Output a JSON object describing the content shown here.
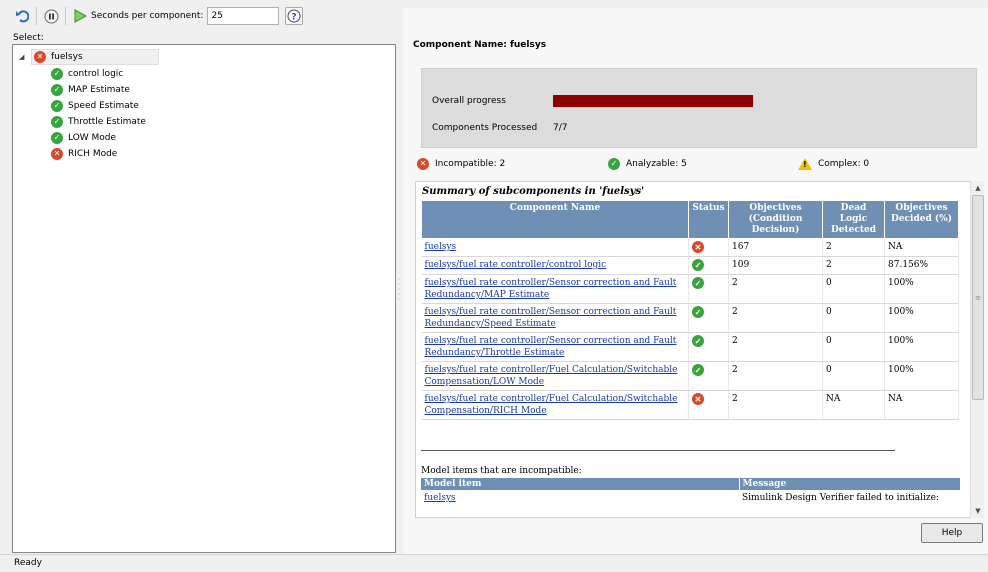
{
  "toolbar": {
    "undo_icon": "undo-icon",
    "pause_icon": "pause-icon",
    "play_icon": "play-icon",
    "seconds_label": "Seconds per component:",
    "seconds_value": "25",
    "help_icon": "help-icon"
  },
  "left": {
    "select_label": "Select:",
    "tree": {
      "root": {
        "label": "fuelsys",
        "status": "error"
      },
      "children": [
        {
          "label": "control logic",
          "status": "ok"
        },
        {
          "label": "MAP Estimate",
          "status": "ok"
        },
        {
          "label": "Speed Estimate",
          "status": "ok"
        },
        {
          "label": "Throttle Estimate",
          "status": "ok"
        },
        {
          "label": "LOW Mode",
          "status": "ok"
        },
        {
          "label": "RICH Mode",
          "status": "error"
        }
      ]
    }
  },
  "status_bar": {
    "text": "Ready"
  },
  "right": {
    "component_name": "Component Name: fuelsys",
    "progress": {
      "overall_label": "Overall progress",
      "overall_fraction": 1.0,
      "processed_label": "Components Processed",
      "processed_value": "7/7"
    },
    "legend": {
      "incompatible": "Incompatible: 2",
      "analyzable": "Analyzable: 5",
      "complex": "Complex: 0"
    },
    "report": {
      "title": "Summary of subcomponents in 'fuelsys'",
      "headers": [
        "Component Name",
        "Status",
        "Objectives (Condition Decision)",
        "Dead Logic Detected",
        "Objectives Decided (%)"
      ],
      "rows": [
        {
          "name": "fuelsys",
          "status": "error",
          "objectives": "167",
          "dead": "2",
          "decided": "NA"
        },
        {
          "name": "fuelsys/fuel rate controller/control logic",
          "status": "ok",
          "objectives": "109",
          "dead": "2",
          "decided": "87.156%"
        },
        {
          "name": "fuelsys/fuel rate controller/Sensor correction and Fault Redundancy/MAP Estimate",
          "status": "ok",
          "objectives": "2",
          "dead": "0",
          "decided": "100%"
        },
        {
          "name": "fuelsys/fuel rate controller/Sensor correction and Fault Redundancy/Speed Estimate",
          "status": "ok",
          "objectives": "2",
          "dead": "0",
          "decided": "100%"
        },
        {
          "name": "fuelsys/fuel rate controller/Sensor correction and Fault Redundancy/Throttle Estimate",
          "status": "ok",
          "objectives": "2",
          "dead": "0",
          "decided": "100%"
        },
        {
          "name": "fuelsys/fuel rate controller/Fuel Calculation/Switchable Compensation/LOW Mode",
          "status": "ok",
          "objectives": "2",
          "dead": "0",
          "decided": "100%"
        },
        {
          "name": "fuelsys/fuel rate controller/Fuel Calculation/Switchable Compensation/RICH Mode",
          "status": "error",
          "objectives": "2",
          "dead": "NA",
          "decided": "NA"
        }
      ],
      "incompatible_title": "Model items that are incompatible:",
      "incompatible_headers": [
        "Model item",
        "Message"
      ],
      "incompatible_rows": [
        {
          "item": "fuelsys",
          "message": "Simulink Design Verifier failed to initialize:"
        }
      ]
    },
    "help_label": "Help"
  },
  "colors": {
    "progress_fill": "#8b0000",
    "table_header": "#6f90b4",
    "ok_icon": "#3ba33b",
    "error_icon": "#d44a2a",
    "warning_icon": "#f2c200",
    "link": "#1a3aa8"
  }
}
